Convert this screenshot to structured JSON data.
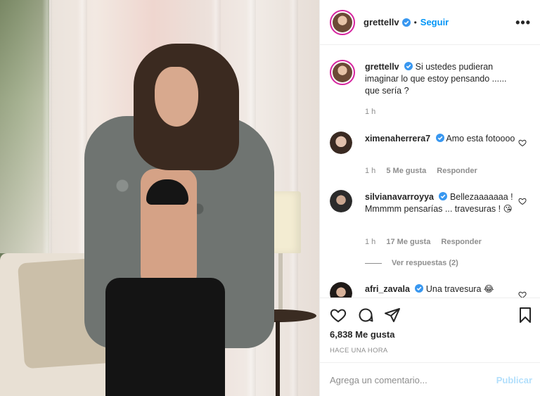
{
  "post": {
    "author": "grettellv",
    "follow_label": "Seguir",
    "separator": "•",
    "more_label": "•••"
  },
  "caption": {
    "username": "grettellv",
    "text": "Si ustedes pudieran imaginar lo que estoy pensando ...... que sería ?",
    "time": "1 h"
  },
  "comments": [
    {
      "username": "ximenaherrera7",
      "text": "Amo esta fotoooo",
      "time": "1 h",
      "likes": "5 Me gusta",
      "reply": "Responder"
    },
    {
      "username": "silvianavarroyya",
      "text": "Bellezaaaaaaa ! Mmmmm pensarías ... travesuras ! 😘",
      "time": "1 h",
      "likes": "17 Me gusta",
      "reply": "Responder"
    },
    {
      "username": "afri_zavala",
      "text": "Una travesura 😂"
    }
  ],
  "view_replies": "Ver respuestas (2)",
  "stats": {
    "likes": "6,838 Me gusta",
    "time_ago": "HACE UNA HORA"
  },
  "composer": {
    "placeholder": "Agrega un comentario...",
    "publish_label": "Publicar"
  },
  "colors": {
    "accent": "#0095f6",
    "publish_disabled": "#b2dffc",
    "meta_gray": "#8e8e8e"
  }
}
